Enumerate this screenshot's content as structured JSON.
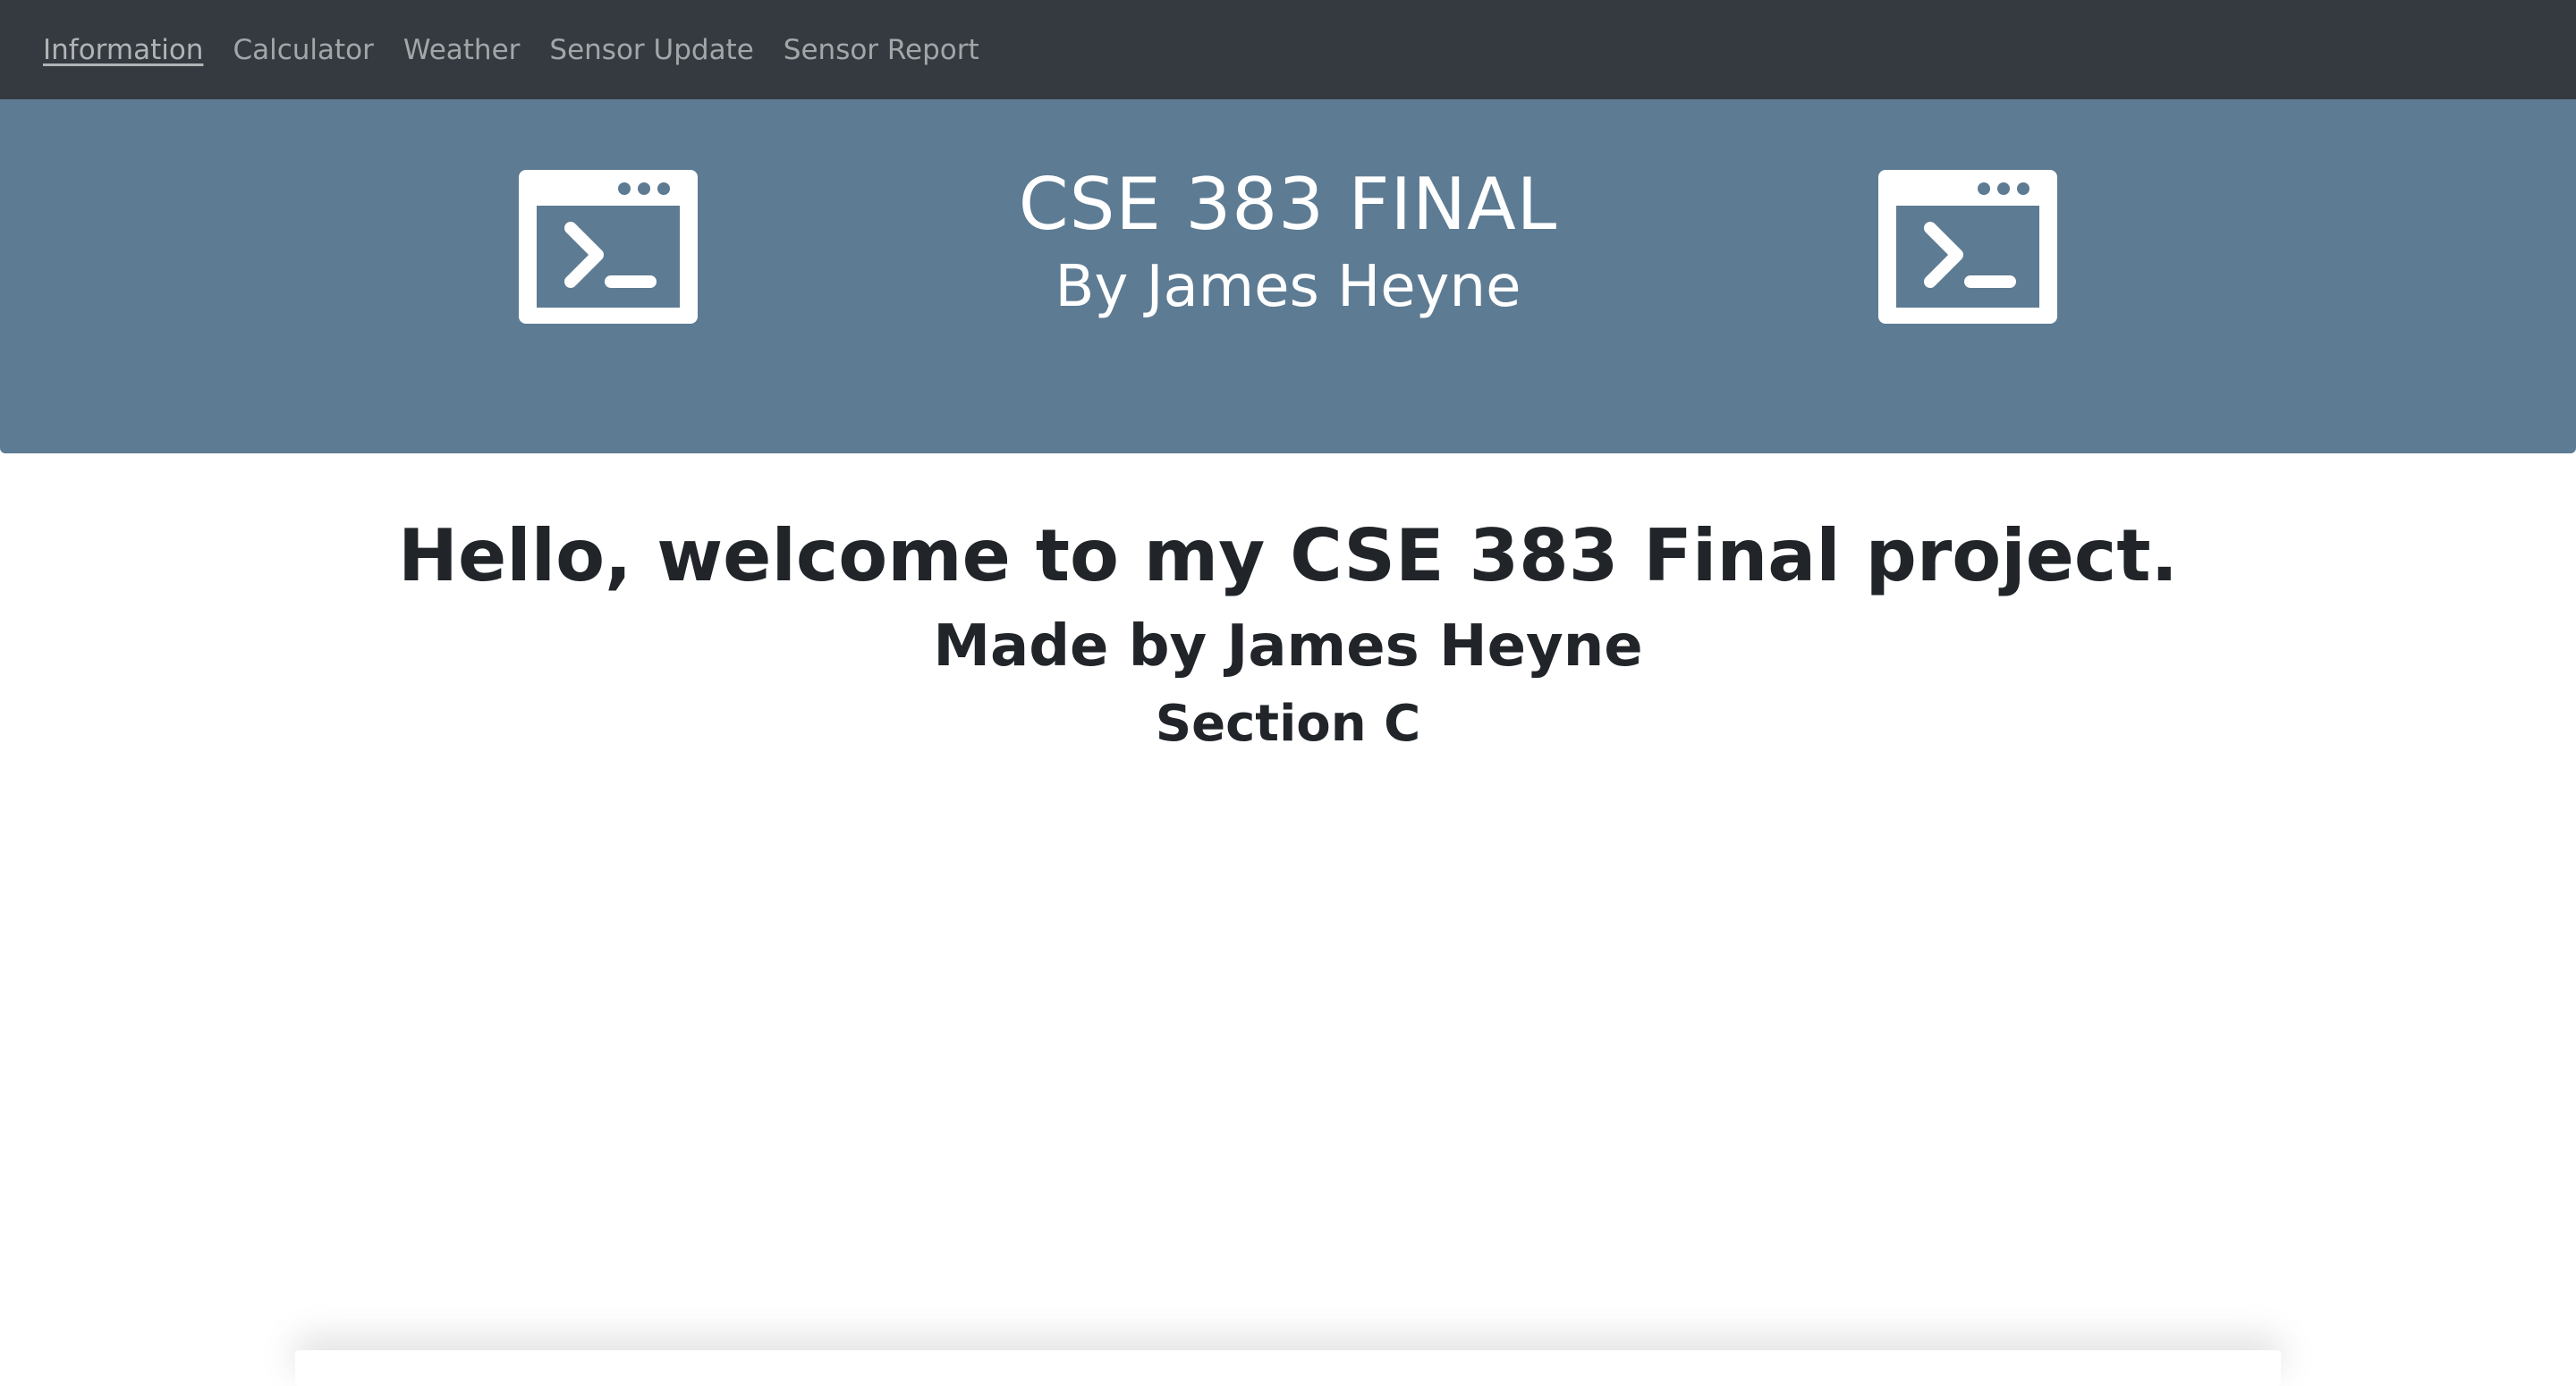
{
  "nav": {
    "items": [
      {
        "label": "Information",
        "active": true
      },
      {
        "label": "Calculator",
        "active": false
      },
      {
        "label": "Weather",
        "active": false
      },
      {
        "label": "Sensor Update",
        "active": false
      },
      {
        "label": "Sensor Report",
        "active": false
      }
    ]
  },
  "banner": {
    "title": "CSE 383 FINAL",
    "subtitle": "By James Heyne",
    "icon_left": "terminal-icon",
    "icon_right": "terminal-icon",
    "background_color": "#5d7b93"
  },
  "main": {
    "welcome": "Hello, welcome to my CSE 383 Final project.",
    "made_by": "Made by James Heyne",
    "section": "Section C"
  },
  "colors": {
    "navbar": "#343a40",
    "nav_link": "rgba(255,255,255,0.55)",
    "text": "#212529"
  }
}
